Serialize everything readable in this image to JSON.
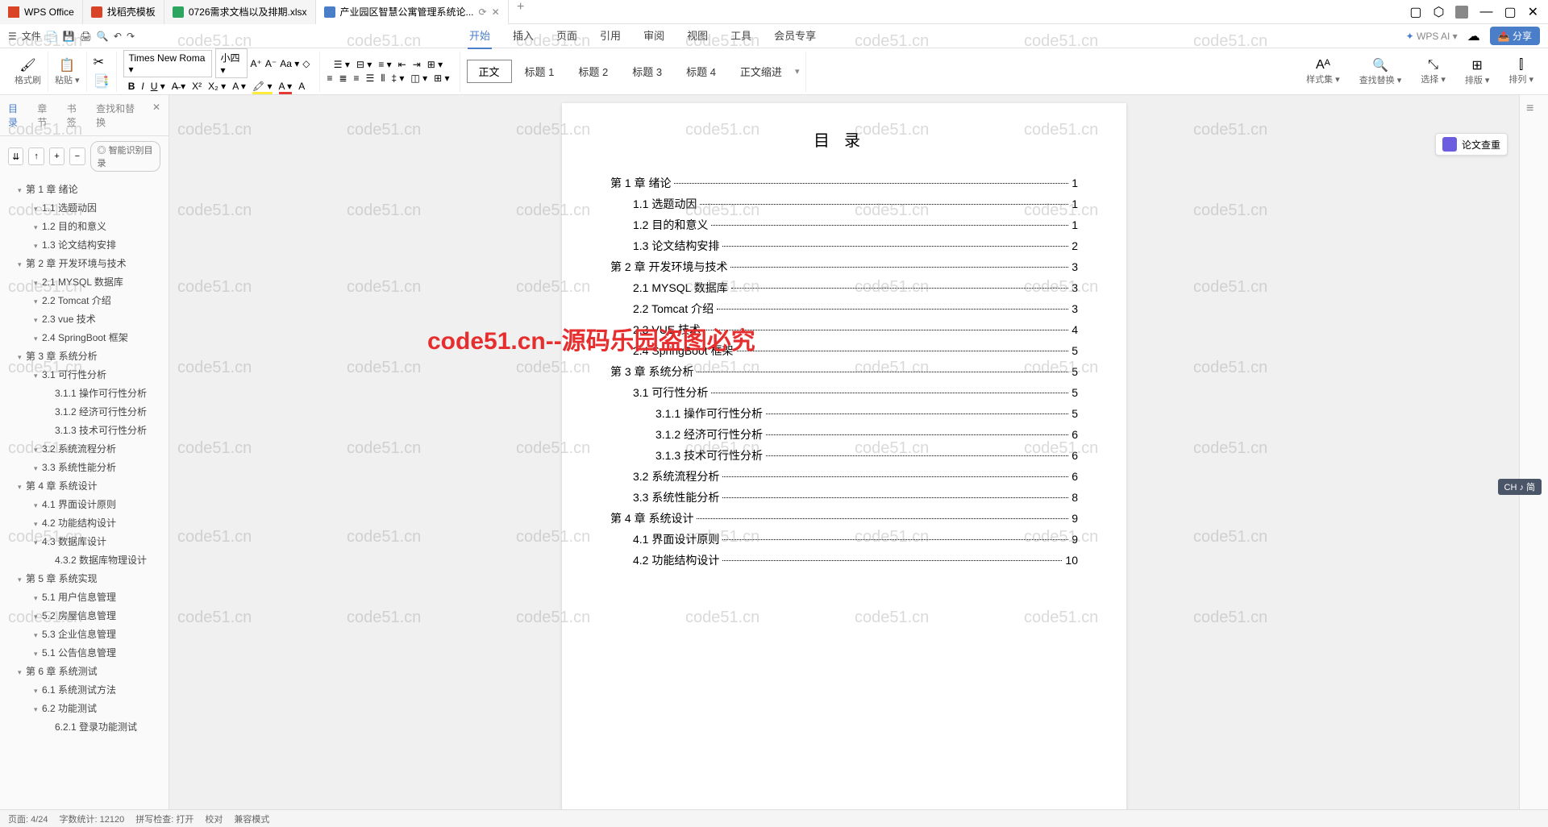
{
  "titlebar": {
    "tabs": [
      {
        "label": "WPS Office",
        "icon": "wps"
      },
      {
        "label": "找稻壳模板",
        "icon": "red"
      },
      {
        "label": "0726需求文档以及排期.xlsx",
        "icon": "green"
      },
      {
        "label": "产业园区智慧公寓管理系统论...",
        "icon": "blue"
      }
    ]
  },
  "menubar": {
    "file": "文件",
    "tabs": [
      "开始",
      "插入",
      "页面",
      "引用",
      "审阅",
      "视图",
      "工具",
      "会员专享"
    ],
    "wps_ai": "WPS AI",
    "share": "分享"
  },
  "ribbon": {
    "format_painter": "格式刷",
    "paste": "粘贴",
    "font_name": "Times New Roma",
    "font_size": "小四",
    "style_normal": "正文",
    "style_h1": "标题 1",
    "style_h2": "标题 2",
    "style_h3": "标题 3",
    "style_h4": "标题 4",
    "style_indent": "正文缩进",
    "style_set": "样式集",
    "find_replace": "查找替换",
    "select": "选择",
    "layout": "排版",
    "sort": "排列"
  },
  "sidebar": {
    "tabs": {
      "toc": "目录",
      "chapter": "章节",
      "bookmark": "书签",
      "find": "查找和替换"
    },
    "smart_toc": "智能识别目录",
    "outline": [
      {
        "level": 1,
        "text": "第 1 章 绪论"
      },
      {
        "level": 2,
        "text": "1.1 选题动因"
      },
      {
        "level": 2,
        "text": "1.2 目的和意义"
      },
      {
        "level": 2,
        "text": "1.3 论文结构安排"
      },
      {
        "level": 1,
        "text": "第 2 章 开发环境与技术"
      },
      {
        "level": 2,
        "text": "2.1 MYSQL 数据库"
      },
      {
        "level": 2,
        "text": "2.2 Tomcat 介绍"
      },
      {
        "level": 2,
        "text": "2.3 vue 技术"
      },
      {
        "level": 2,
        "text": "2.4 SpringBoot 框架"
      },
      {
        "level": 1,
        "text": "第 3 章 系统分析"
      },
      {
        "level": 2,
        "text": "3.1 可行性分析"
      },
      {
        "level": 3,
        "text": "3.1.1 操作可行性分析"
      },
      {
        "level": 3,
        "text": "3.1.2 经济可行性分析"
      },
      {
        "level": 3,
        "text": "3.1.3 技术可行性分析"
      },
      {
        "level": 2,
        "text": "3.2 系统流程分析"
      },
      {
        "level": 2,
        "text": "3.3 系统性能分析"
      },
      {
        "level": 1,
        "text": "第 4 章 系统设计"
      },
      {
        "level": 2,
        "text": "4.1 界面设计原则"
      },
      {
        "level": 2,
        "text": "4.2 功能结构设计"
      },
      {
        "level": 2,
        "text": "4.3 数据库设计"
      },
      {
        "level": 3,
        "text": "4.3.2 数据库物理设计"
      },
      {
        "level": 1,
        "text": "第 5 章 系统实现"
      },
      {
        "level": 2,
        "text": "5.1 用户信息管理"
      },
      {
        "level": 2,
        "text": "5.2 房屋信息管理"
      },
      {
        "level": 2,
        "text": "5.3 企业信息管理"
      },
      {
        "level": 2,
        "text": "5.1 公告信息管理"
      },
      {
        "level": 1,
        "text": "第 6 章 系统测试"
      },
      {
        "level": 2,
        "text": "6.1 系统测试方法"
      },
      {
        "level": 2,
        "text": "6.2 功能测试"
      },
      {
        "level": 3,
        "text": "6.2.1 登录功能测试"
      }
    ]
  },
  "document": {
    "title": "目录",
    "toc": [
      {
        "level": 1,
        "text": "第 1 章  绪论",
        "page": "1"
      },
      {
        "level": 2,
        "text": "1.1 选题动因",
        "page": "1"
      },
      {
        "level": 2,
        "text": "1.2 目的和意义",
        "page": "1"
      },
      {
        "level": 2,
        "text": "1.3 论文结构安排",
        "page": "2"
      },
      {
        "level": 1,
        "text": "第 2 章  开发环境与技术",
        "page": "3"
      },
      {
        "level": 2,
        "text": "2.1 MYSQL 数据库",
        "page": "3"
      },
      {
        "level": 2,
        "text": "2.2 Tomcat 介绍",
        "page": "3"
      },
      {
        "level": 2,
        "text": "2.3 VUE 技术",
        "page": "4"
      },
      {
        "level": 2,
        "text": "2.4 SpringBoot 框架",
        "page": "5"
      },
      {
        "level": 1,
        "text": "第 3 章  系统分析",
        "page": "5"
      },
      {
        "level": 2,
        "text": "3.1 可行性分析",
        "page": "5"
      },
      {
        "level": 3,
        "text": "3.1.1 操作可行性分析",
        "page": "5"
      },
      {
        "level": 3,
        "text": "3.1.2 经济可行性分析",
        "page": "6"
      },
      {
        "level": 3,
        "text": "3.1.3 技术可行性分析",
        "page": "6"
      },
      {
        "level": 2,
        "text": "3.2 系统流程分析",
        "page": "6"
      },
      {
        "level": 2,
        "text": "3.3 系统性能分析",
        "page": "8"
      },
      {
        "level": 1,
        "text": "第 4 章  系统设计",
        "page": "9"
      },
      {
        "level": 2,
        "text": "4.1 界面设计原则",
        "page": "9"
      },
      {
        "level": 2,
        "text": "4.2 功能结构设计",
        "page": "10"
      }
    ]
  },
  "floating": {
    "thesis_check": "论文查重"
  },
  "ime": "CH ♪ 简",
  "watermark_text": "code51.cn",
  "red_watermark": "code51.cn--源码乐园盗图必究",
  "statusbar": {
    "page": "页面: 4/24",
    "words": "字数统计: 12120",
    "mode1": "拼写检查: 打开",
    "mode2": "校对",
    "mode3": "兼容模式"
  }
}
